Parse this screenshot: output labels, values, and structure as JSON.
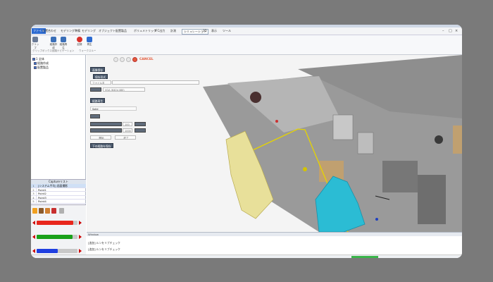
{
  "menubar": {
    "file_tab": "ファイル",
    "items": [
      "位置合わせ",
      "モデリング準備",
      "モデリング",
      "オブジェクト",
      "配置製品",
      "ボリュメトリック",
      "IFC出力",
      "計測",
      "シミュレーション",
      "3D",
      "表示",
      "ツール"
    ],
    "selected_index": 8
  },
  "ribbon": {
    "buttons": [
      {
        "label": "クリップ",
        "icon": "clip-icon",
        "color": "#6a7a96"
      },
      {
        "label": "経路作成",
        "icon": "path-create-icon",
        "color": "#3b6fb8"
      },
      {
        "label": "経路再生",
        "icon": "path-play-icon",
        "color": "#3b6fb8"
      },
      {
        "label": "記録",
        "icon": "record-icon",
        "color": "#d9302a"
      },
      {
        "label": "再生",
        "icon": "play-icon",
        "color": "#2c6ad1"
      }
    ],
    "groups": [
      "クリップボックス",
      "経路ナビゲーション",
      "ウォークスルー"
    ]
  },
  "tree": {
    "items": [
      {
        "label": "1 全体",
        "checked": true
      },
      {
        "label": "経路作成",
        "checked": true
      },
      {
        "label": "配置製品",
        "checked": true
      }
    ]
  },
  "capture": {
    "title": "Captureリスト",
    "rows": [
      {
        "num": "1",
        "name": "[シスチム平均] 画面撮影"
      },
      {
        "num": "2",
        "name": "Point1"
      },
      {
        "num": "3",
        "name": "Point2"
      },
      {
        "num": "4",
        "name": "Point3"
      },
      {
        "num": "5",
        "name": "Point4"
      }
    ]
  },
  "color_bars": [
    {
      "name": "red",
      "color": "#e8261c",
      "value": 0.9
    },
    {
      "name": "green",
      "color": "#1aa11a",
      "value": 0.88
    },
    {
      "name": "blue",
      "color": "#1f3fe0",
      "value": 0.52
    }
  ],
  "dialog": {
    "cancel": "CANCEL",
    "section1_title": "画像保存",
    "section1_btn": "保存形式",
    "file_label": "ファイル名",
    "resolution_value": "VGA (640×480)",
    "section2_title": "経路再生",
    "speed_select": "Solid",
    "value_a": "100",
    "value_b": "1000",
    "btn_start": "開始",
    "btn_end": "終了",
    "btn_save_all": "下の経路を保存"
  },
  "output": {
    "title": "Window",
    "lines": [
      "[追加] ルンをリブチェック",
      "[追加] ルンをリブチェック"
    ]
  },
  "colors": {
    "accent": "#2c6ad1",
    "highlight_box": "#2bbcd4",
    "path_line": "#e6d400",
    "model": "#e8e09a"
  }
}
